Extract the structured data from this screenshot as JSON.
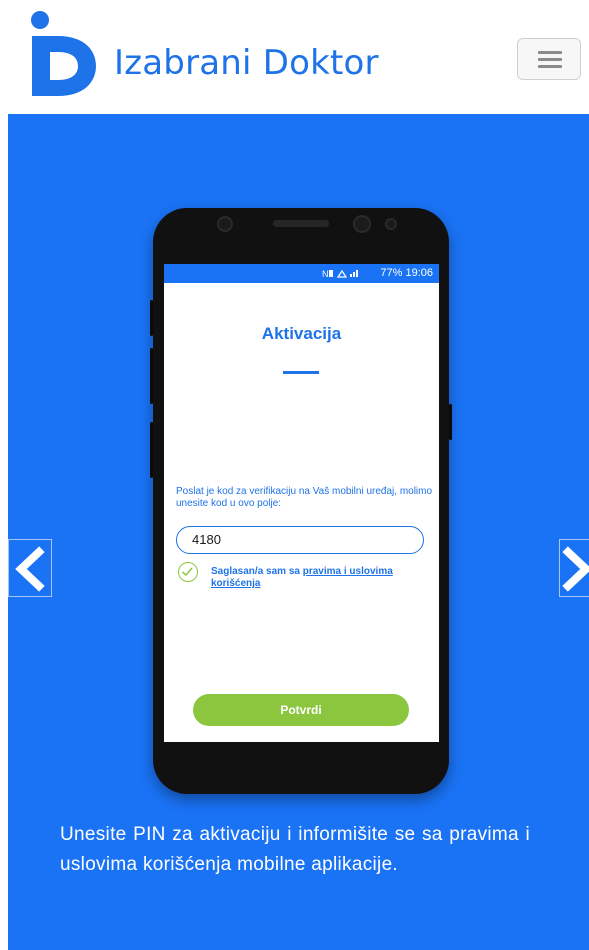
{
  "header": {
    "brand_name": "Izabrani Doktor",
    "logo_icon": "id-logo-icon",
    "menu_icon": "hamburger-menu-icon",
    "brand_color": "#1e73e8"
  },
  "hero": {
    "background_color": "#1a73f5",
    "prev_icon": "chevron-left-icon",
    "next_icon": "chevron-right-icon",
    "caption": "Unesite PIN za aktivaciju i informišite se sa pravima i uslovima korišćenja mobilne aplikacije."
  },
  "phone": {
    "status_bar": {
      "text": "77% 19:06",
      "icons": [
        "nfc-icon",
        "wifi-icon",
        "signal-icon",
        "battery-icon"
      ]
    },
    "screen": {
      "title": "Aktivacija",
      "hint": "Poslat je kod za verifikaciju na Vaš mobilni uređaj, molimo unesite kod u ovo polje:",
      "pin_value": "4180",
      "consent_prefix": "Saglasan/a sam sa ",
      "consent_link": "pravima i uslovima korišćenja",
      "consent_checked": true,
      "confirm_label": "Potvrdi",
      "accent_color": "#8cc63f"
    }
  }
}
